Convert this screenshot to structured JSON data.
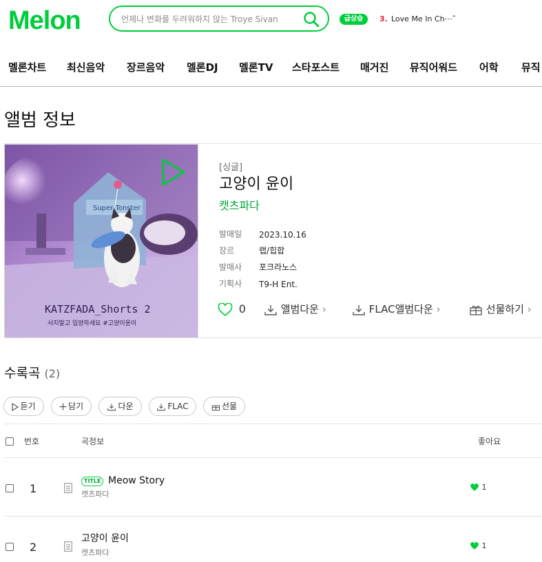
{
  "header": {
    "logo": "Melon",
    "search_placeholder": "언제나 변화를 두려워하지 않는 Troye Sivan",
    "rising_badge": "급상승",
    "rising_rank": "3.",
    "rising_title": "Love Me In Ch⋯˜"
  },
  "nav": [
    "멜론차트",
    "최신음악",
    "장르음악",
    "멜론DJ",
    "멜론TV",
    "스타포스트",
    "매거진",
    "뮤직어워드",
    "어학",
    "뮤직"
  ],
  "page_title": "앨범 정보",
  "album": {
    "kind": "[싱글]",
    "name": "고양이 윤이",
    "artist": "캣츠파다",
    "cover_text_line1": "KATZFADA_Shorts 2",
    "cover_text_line2": "사지말고 입양하세요 #고양이윤이",
    "cover_box_text": "Super  Tonster",
    "meta": [
      {
        "key": "발매일",
        "value": "2023.10.16"
      },
      {
        "key": "장르",
        "value": "랩/힙합"
      },
      {
        "key": "발매사",
        "value": "포크라노스"
      },
      {
        "key": "기획사",
        "value": "T9-H Ent."
      }
    ],
    "like_count": "0",
    "actions": {
      "download": "앨범다운",
      "flac": "FLAC앨범다운",
      "gift": "선물하기"
    }
  },
  "tracklist": {
    "title": "수록곡",
    "count": "(2)",
    "buttons": {
      "listen": "듣기",
      "add": "담기",
      "download": "다운",
      "flac": "FLAC",
      "gift": "선물"
    },
    "headers": {
      "number": "번호",
      "info": "곡정보",
      "like": "좋아요"
    },
    "title_badge": "TITLE",
    "rows": [
      {
        "no": "1",
        "title": "Meow Story",
        "artist": "캣츠파다",
        "likes": "1",
        "is_title": true
      },
      {
        "no": "2",
        "title": "고양이 윤이",
        "artist": "캣츠파다",
        "likes": "1",
        "is_title": false
      }
    ]
  },
  "colors": {
    "accent": "#00cd3c",
    "rank_red": "#e3272f"
  }
}
